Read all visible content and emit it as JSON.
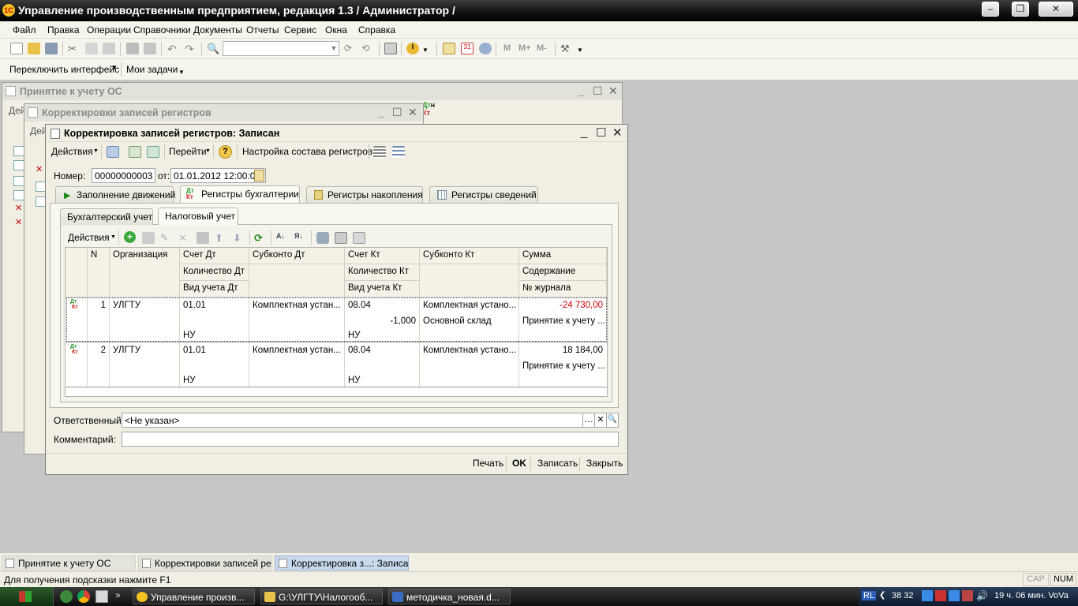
{
  "app": {
    "title": "Управление производственным предприятием, редакция 1.3 / Администратор /",
    "logo": "1С"
  },
  "menu": [
    "Файл",
    "Правка",
    "Операции",
    "Справочники",
    "Документы",
    "Отчеты",
    "Сервис",
    "Окна",
    "Справка"
  ],
  "toolbar2": {
    "switch_interface": "Переключить интерфейс",
    "my_tasks": "Мои задачи"
  },
  "bg_windows": {
    "w1_title": "Принятие к учету ОС",
    "w1_partial": "Дей",
    "w2_title": "Корректировки записей регистров",
    "w2_partial": "Дей"
  },
  "form": {
    "title": "Корректировка записей регистров: Записан",
    "toolbar": {
      "actions": "Действия",
      "go": "Перейти",
      "help": "?",
      "setup": "Настройка состава регистров"
    },
    "number_label": "Номер:",
    "number": "00000000003",
    "date_label": "от:",
    "date": "01.01.2012 12:00:02",
    "tabs": [
      "Заполнение движений",
      "Регистры бухгалтерии",
      "Регистры накопления",
      "Регистры сведений"
    ],
    "subtabs": [
      "Бухгалтерский учет",
      "Налоговый учет"
    ],
    "grid_actions": "Действия",
    "columns": {
      "n": "N",
      "org": "Организация",
      "acc_dt": "Счет Дт",
      "qty_dt": "Количество Дт",
      "type_dt": "Вид учета Дт",
      "sub_dt": "Субконто Дт",
      "acc_kt": "Счет Кт",
      "qty_kt": "Количество Кт",
      "type_kt": "Вид учета Кт",
      "sub_kt": "Субконто Кт",
      "sum": "Сумма",
      "content": "Содержание",
      "journal": "№ журнала"
    },
    "rows": [
      {
        "n": "1",
        "org": "УЛГТУ",
        "acc_dt": "01.01",
        "sub_dt": "Комплектная устан...",
        "type_dt": "НУ",
        "acc_kt": "08.04",
        "qty_kt": "-1,000",
        "type_kt": "НУ",
        "sub_kt": "Комплектная устано...",
        "sub_kt2": "Основной склад",
        "sum": "-24 730,00",
        "content": "Принятие к учету ..."
      },
      {
        "n": "2",
        "org": "УЛГТУ",
        "acc_dt": "01.01",
        "sub_dt": "Комплектная устан...",
        "type_dt": "НУ",
        "acc_kt": "08.04",
        "qty_kt": "",
        "type_kt": "НУ",
        "sub_kt": "Комплектная устано...",
        "sub_kt2": "",
        "sum": "18 184,00",
        "content": "Принятие к учету ..."
      }
    ],
    "responsible_label": "Ответственный:",
    "responsible": "<Не указан>",
    "comment_label": "Комментарий:",
    "comment": "",
    "buttons": {
      "print": "Печать",
      "ok": "OK",
      "save": "Записать",
      "close": "Закрыть"
    }
  },
  "window_tabs": [
    "Принятие к учету ОС",
    "Корректировки записей ре...",
    "Корректировка з...: Записан"
  ],
  "status": {
    "hint": "Для получения подсказки нажмите F1",
    "cap": "CAP",
    "num": "NUM"
  },
  "taskbar": {
    "items": [
      "Управление произв...",
      "G:\\УЛГТУ\\Налогооб...",
      "методичка_новая.d..."
    ],
    "lang": "RL",
    "tray_numbers": "38 32",
    "clock": "19 ч. 06 мин. VoVa"
  },
  "colors": {
    "negative": "#cc0000",
    "accent_green": "#2a9a2a",
    "dtkt_red": "#cc2020"
  }
}
